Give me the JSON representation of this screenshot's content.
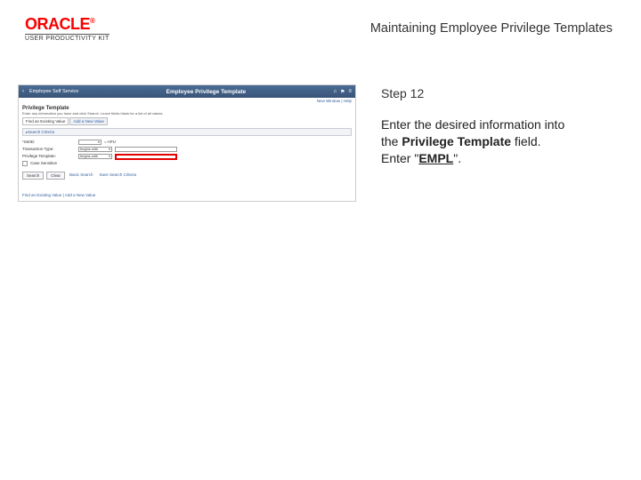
{
  "header": {
    "logo_text": "ORACLE",
    "logo_tm": "®",
    "logo_subtitle": "USER PRODUCTIVITY KIT",
    "doc_title": "Maintaining Employee Privilege Templates"
  },
  "instruction": {
    "step_label": "Step 12",
    "line1": "Enter the desired information into",
    "line2a": "the ",
    "line2b_bold": "Privilege Template",
    "line2c": " field.",
    "line3a": "Enter \"",
    "line3b_value": "EMPL",
    "line3c": "\"."
  },
  "app": {
    "back_label": "‹",
    "bar_label1": "Employee Self Service",
    "bar_title": "Employee Privilege Template",
    "top_icons": {
      "home": "home-icon",
      "flag": "flag-icon",
      "menu": "menu-icon"
    },
    "top_links": "New Window | Help",
    "page_heading": "Privilege Template",
    "page_sub": "Enter any information you have and click Search. Leave fields blank for a list of all values.",
    "tabs": [
      "Find an Existing Value",
      "Add a New Value"
    ],
    "section_title": "Search Criteria",
    "fields": {
      "setid": {
        "label": "*SetID:",
        "value": "= APU"
      },
      "trans_type": {
        "label": "Transaction Type:",
        "value": "begins with"
      },
      "priv_tmpl": {
        "label": "Privilege Template:",
        "value": "begins with"
      },
      "case_sensitive": {
        "label": "Case Sensitive"
      }
    },
    "buttons": {
      "search": "Search",
      "clear": "Clear"
    },
    "links": {
      "basic": "Basic Search",
      "save": "Save Search Criteria"
    },
    "footer": "Find an Existing Value | Add a New Value"
  }
}
